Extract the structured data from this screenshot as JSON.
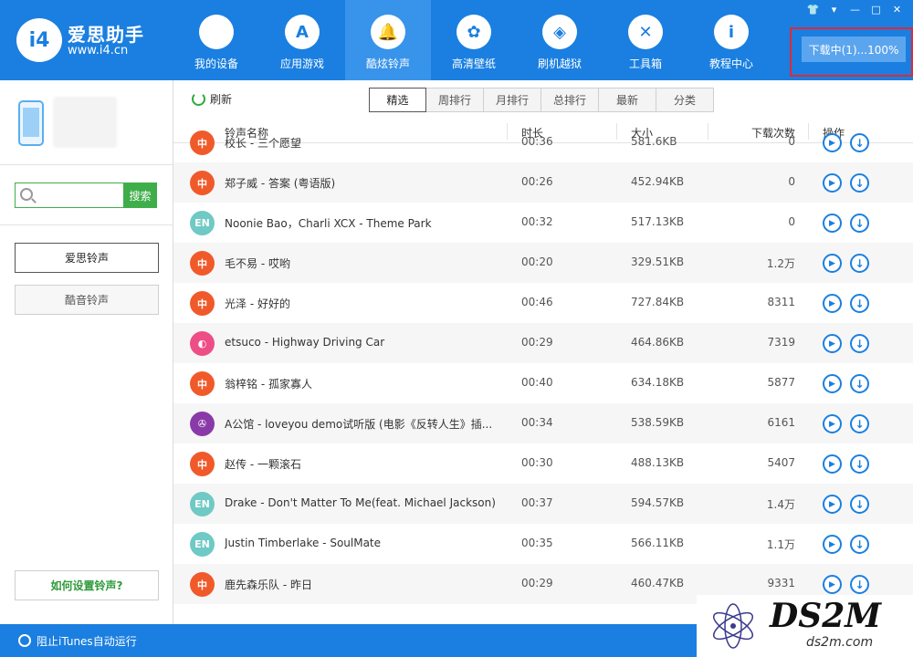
{
  "app": {
    "logo_mark": "i4",
    "name": "爱思助手",
    "url": "www.i4.cn"
  },
  "nav": {
    "items": [
      {
        "label": "我的设备",
        "icon": "apple-icon",
        "glyph": ""
      },
      {
        "label": "应用游戏",
        "icon": "app-store-icon",
        "glyph": "A"
      },
      {
        "label": "酷炫铃声",
        "icon": "bell-icon",
        "glyph": "🔔"
      },
      {
        "label": "高清壁纸",
        "icon": "flower-icon",
        "glyph": "✿"
      },
      {
        "label": "刷机越狱",
        "icon": "dropbox-icon",
        "glyph": "◈"
      },
      {
        "label": "工具箱",
        "icon": "tools-icon",
        "glyph": "✕"
      },
      {
        "label": "教程中心",
        "icon": "info-icon",
        "glyph": "i"
      }
    ],
    "active_index": 2
  },
  "window": {
    "controls": [
      "👕",
      "▾",
      "—",
      "□",
      "✕"
    ]
  },
  "download": {
    "label": "下载中(1)...100%"
  },
  "sidebar": {
    "search_placeholder": "",
    "search_button": "搜索",
    "buttons": [
      "爱思铃声",
      "酷音铃声"
    ],
    "help": "如何设置铃声?"
  },
  "toolbar": {
    "refresh_label": "刷新",
    "tabs": [
      "精选",
      "周排行",
      "月排行",
      "总排行",
      "最新",
      "分类"
    ],
    "active_tab": 0
  },
  "table": {
    "headers": {
      "name": "铃声名称",
      "duration": "时长",
      "size": "大小",
      "downloads": "下载次数",
      "actions": "操作"
    },
    "rows": [
      {
        "badge": "中",
        "badge_color": "#f05a2a",
        "name": "校长 - 三个愿望",
        "duration": "00:36",
        "size": "581.6KB",
        "downloads": "0"
      },
      {
        "badge": "中",
        "badge_color": "#f05a2a",
        "name": "郑子威 - 答案 (粤语版)",
        "duration": "00:26",
        "size": "452.94KB",
        "downloads": "0"
      },
      {
        "badge": "EN",
        "badge_color": "#6fc9c4",
        "name": "Noonie Bao，Charli XCX - Theme Park",
        "duration": "00:32",
        "size": "517.13KB",
        "downloads": "0"
      },
      {
        "badge": "中",
        "badge_color": "#f05a2a",
        "name": "毛不易 - 哎哟",
        "duration": "00:20",
        "size": "329.51KB",
        "downloads": "1.2万"
      },
      {
        "badge": "中",
        "badge_color": "#f05a2a",
        "name": "光泽 - 好好的",
        "duration": "00:46",
        "size": "727.84KB",
        "downloads": "8311"
      },
      {
        "badge": "◐",
        "badge_color": "#ee4e86",
        "name": "etsuco - Highway Driving Car",
        "duration": "00:29",
        "size": "464.86KB",
        "downloads": "7319"
      },
      {
        "badge": "中",
        "badge_color": "#f05a2a",
        "name": "翁梓铭 - 孤家寡人",
        "duration": "00:40",
        "size": "634.18KB",
        "downloads": "5877"
      },
      {
        "badge": "✇",
        "badge_color": "#8a3aa8",
        "name": "A公馆 - loveyou demo试听版 (电影《反转人生》插...",
        "duration": "00:34",
        "size": "538.59KB",
        "downloads": "6161"
      },
      {
        "badge": "中",
        "badge_color": "#f05a2a",
        "name": "赵传 - 一颗滚石",
        "duration": "00:30",
        "size": "488.13KB",
        "downloads": "5407"
      },
      {
        "badge": "EN",
        "badge_color": "#6fc9c4",
        "name": "Drake - Don't Matter To Me(feat. Michael Jackson)",
        "duration": "00:37",
        "size": "594.57KB",
        "downloads": "1.4万"
      },
      {
        "badge": "EN",
        "badge_color": "#6fc9c4",
        "name": "Justin Timberlake - SoulMate",
        "duration": "00:35",
        "size": "566.11KB",
        "downloads": "1.1万"
      },
      {
        "badge": "中",
        "badge_color": "#f05a2a",
        "name": "鹿先森乐队 - 昨日",
        "duration": "00:29",
        "size": "460.47KB",
        "downloads": "9331"
      }
    ]
  },
  "statusbar": {
    "itunes_label": "阻止iTunes自动运行"
  },
  "watermark": {
    "big": "DS2M",
    "small": "ds2m.com"
  }
}
